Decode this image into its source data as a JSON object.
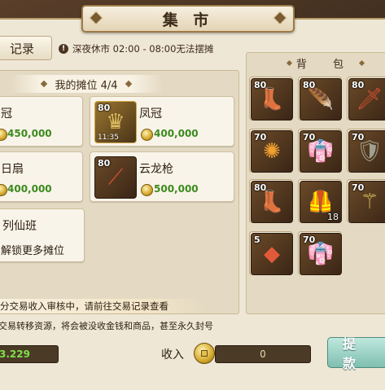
{
  "header": {
    "title": "集 市"
  },
  "record_button": {
    "label": "记录"
  },
  "notice": {
    "icon": "info-icon",
    "text": "深夜休市 02:00 - 08:00无法摆摊"
  },
  "stall": {
    "header": "我的摊位 4/4",
    "cards": [
      {
        "name": "冠",
        "price": "450,000",
        "has_icon": false
      },
      {
        "name": "凤冠",
        "price": "400,000",
        "level": "80",
        "timer": "11:35",
        "icon": "phoenix-crown-icon"
      },
      {
        "name": "日扇",
        "price": "400,000",
        "has_icon": false
      },
      {
        "name": "云龙枪",
        "price": "500,000",
        "level": "80",
        "icon": "spear-icon"
      },
      {
        "name": "列仙班",
        "sub": "解锁更多摊位",
        "has_icon": false
      }
    ]
  },
  "audit_text": "分交易收入审核中，请前往交易记录查看",
  "warning_text": "交易转移资源，将会被没收金钱和商品，甚至永久封号",
  "balance": {
    "value": "3.229"
  },
  "income": {
    "label": "收入",
    "value": "0"
  },
  "withdraw_button": {
    "label": "提 款"
  },
  "bag": {
    "header": "背 包",
    "slots": [
      {
        "level": "80",
        "icon": "boots-icon",
        "glyph": "👢",
        "color": "#7a5ad0"
      },
      {
        "level": "80",
        "icon": "feather-fan-icon",
        "glyph": "🪶",
        "color": "#e8d8c0"
      },
      {
        "level": "80",
        "icon": "spear-icon",
        "glyph": "🗡",
        "color": "#d05030"
      },
      {
        "level": "70",
        "icon": "amulet-icon",
        "glyph": "✺",
        "color": "#f0a030"
      },
      {
        "level": "70",
        "icon": "robe-icon",
        "glyph": "👘",
        "color": "#e0b040"
      },
      {
        "level": "70",
        "icon": "armor-icon",
        "glyph": "🛡",
        "color": "#a0a090"
      },
      {
        "level": "80",
        "icon": "boots-icon",
        "glyph": "👢",
        "color": "#7a5ad0"
      },
      {
        "level": "",
        "icon": "vest-icon",
        "glyph": "🦺",
        "color": "#c07838",
        "count": "18"
      },
      {
        "level": "70",
        "icon": "staff-icon",
        "glyph": "⚚",
        "color": "#d8c060"
      },
      {
        "level": "5",
        "icon": "ore-icon",
        "glyph": "◆",
        "color": "#e05a3a"
      },
      {
        "level": "70",
        "icon": "robe-icon",
        "glyph": "👘",
        "color": "#e0b040"
      }
    ]
  }
}
